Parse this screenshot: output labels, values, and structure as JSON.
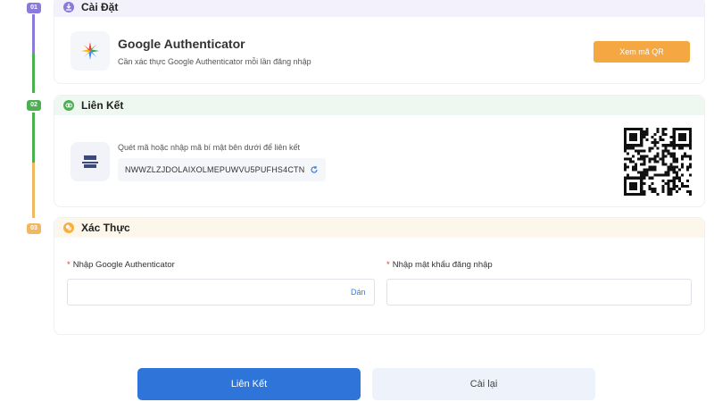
{
  "steps": [
    {
      "badge": "01",
      "title": "Cài Đặt",
      "color": "#8b7bd8"
    },
    {
      "badge": "02",
      "title": "Liên Kết",
      "color": "#4caf50"
    },
    {
      "badge": "03",
      "title": "Xác Thực",
      "color": "#f0b860"
    }
  ],
  "setup": {
    "app_name": "Google Authenticator",
    "description": "Cần xác thực Google Authenticator mỗi lần đăng nhập",
    "qr_button": "Xem mã QR"
  },
  "link": {
    "hint": "Quét mã hoặc nhập mã bí mật bên dưới để liên kết",
    "secret": "NWWZLZJDOLAIXOLMEPUWVU5PUFHS4CTN"
  },
  "verify": {
    "ga_label": "Nhập Google Authenticator",
    "ga_value": "",
    "paste": "Dán",
    "pw_label": "Nhập mật khẩu đăng nhập",
    "pw_value": "",
    "required_mark": "*"
  },
  "actions": {
    "submit": "Liên Kết",
    "reset": "Cài lại"
  }
}
